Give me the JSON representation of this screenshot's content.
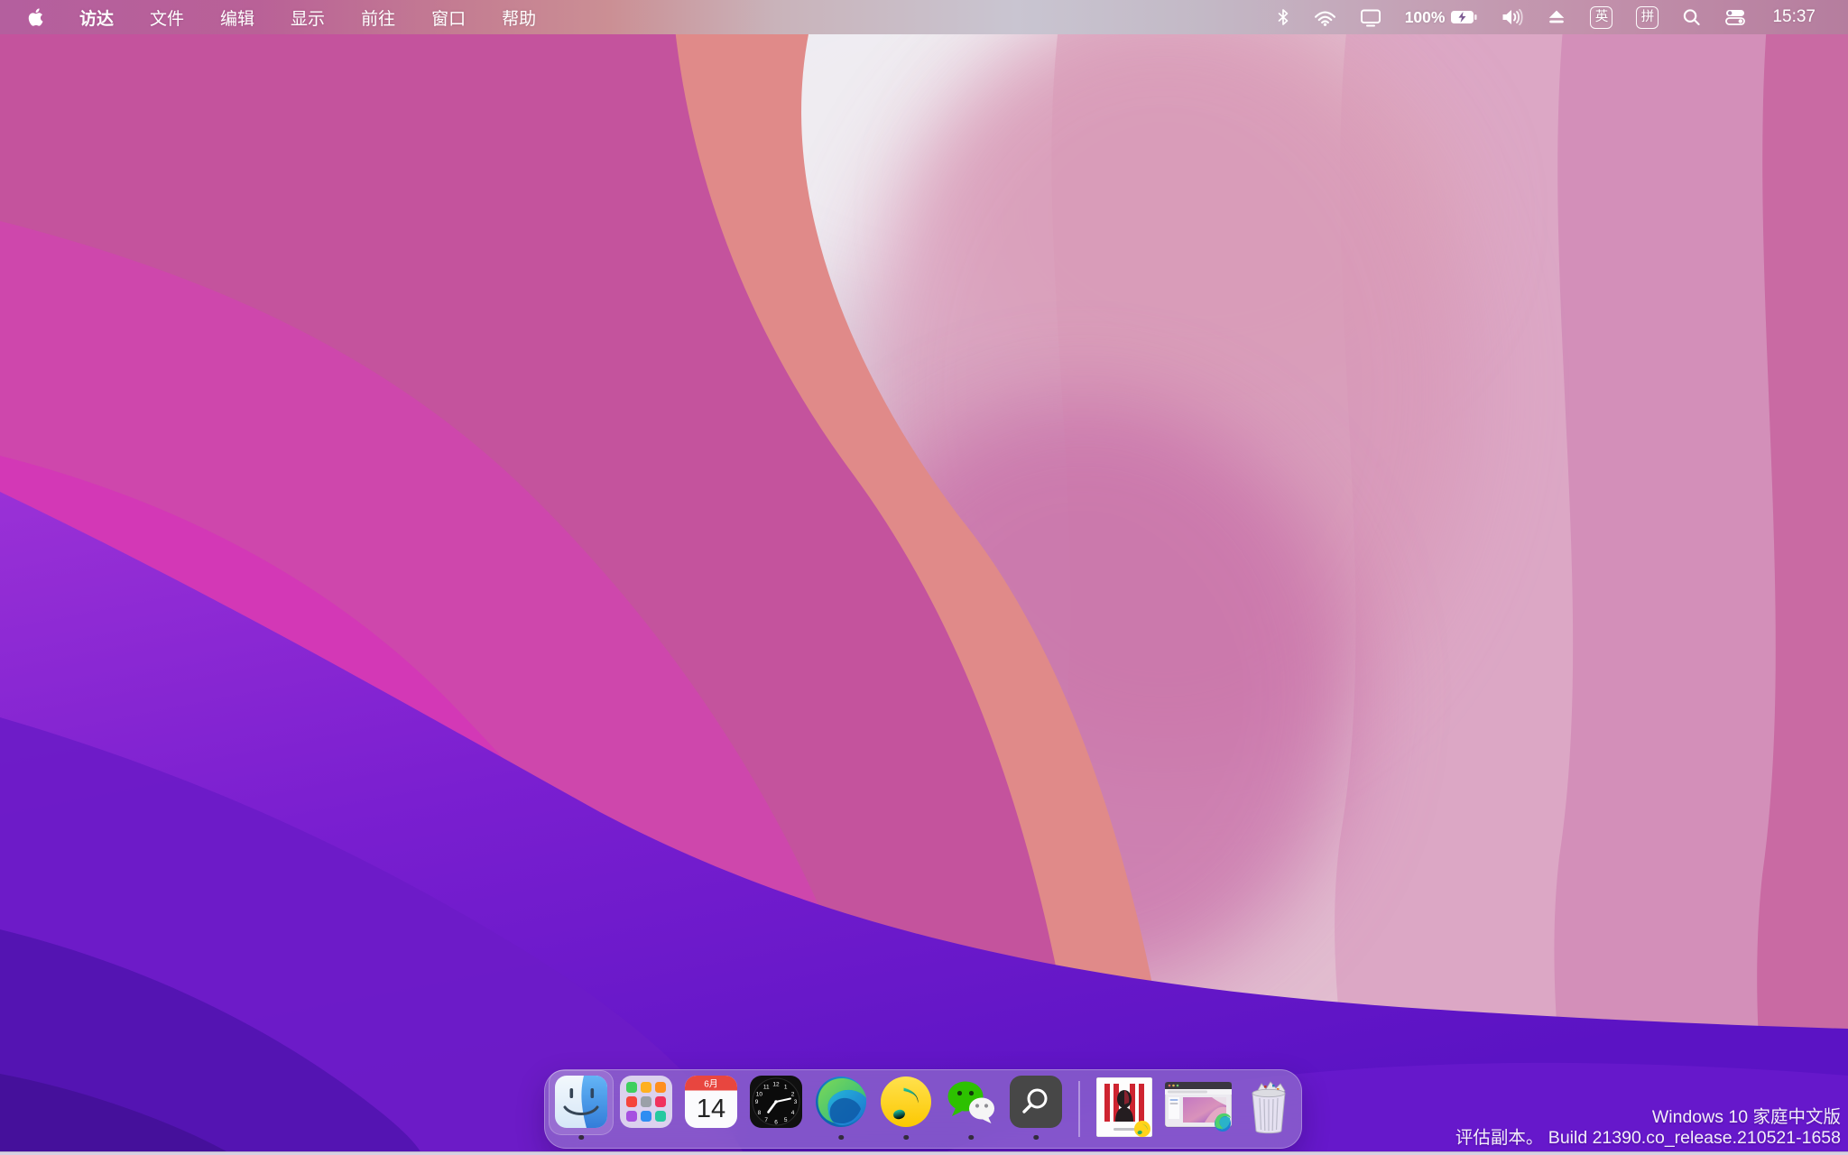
{
  "menu_bar": {
    "menus": [
      {
        "label": "访达"
      },
      {
        "label": "文件"
      },
      {
        "label": "编辑"
      },
      {
        "label": "显示"
      },
      {
        "label": "前往"
      },
      {
        "label": "窗口"
      },
      {
        "label": "帮助"
      }
    ],
    "status": {
      "battery_percent": "100%",
      "battery_state": "charging",
      "input_english": "英",
      "input_pinyin": "拼",
      "time": "15:37",
      "icons": [
        "bluetooth-icon",
        "wifi-icon",
        "display-icon",
        "battery-charging-icon",
        "volume-icon",
        "eject-icon",
        "input-english-badge",
        "input-pinyin-badge",
        "search-icon",
        "control-center-icon"
      ]
    }
  },
  "dock": {
    "apps": [
      {
        "name": "finder",
        "running": true
      },
      {
        "name": "launchpad",
        "running": false
      },
      {
        "name": "calendar",
        "running": false
      },
      {
        "name": "clock",
        "running": false
      },
      {
        "name": "edge",
        "running": true
      },
      {
        "name": "qq-music",
        "running": true
      },
      {
        "name": "wechat",
        "running": true
      },
      {
        "name": "search-app",
        "running": true
      }
    ],
    "calendar": {
      "month": "6月",
      "day": "14"
    },
    "clock": {
      "numerals": [
        "12",
        "1",
        "2",
        "3",
        "4",
        "5",
        "6",
        "7",
        "8",
        "9",
        "10",
        "11"
      ]
    },
    "minimized_windows": [
      {
        "name": "qq-music-album-window",
        "badge": "qq-music"
      },
      {
        "name": "edge-browser-window",
        "badge": "edge"
      }
    ],
    "trash_state": "full"
  },
  "watermark": {
    "line1": "Windows 10 家庭中文版",
    "line2": "评估副本。 Build 21390.co_release.210521-1658"
  },
  "colors": {
    "dock_tint": "#9e88cd",
    "taskbar_strip": "#d6d1e2",
    "wallpaper_palette": [
      "#c4539d",
      "#e08a89",
      "#d9d4df",
      "#d338b6",
      "#8c2ad4",
      "#5b13c4",
      "#c96aa3"
    ]
  }
}
